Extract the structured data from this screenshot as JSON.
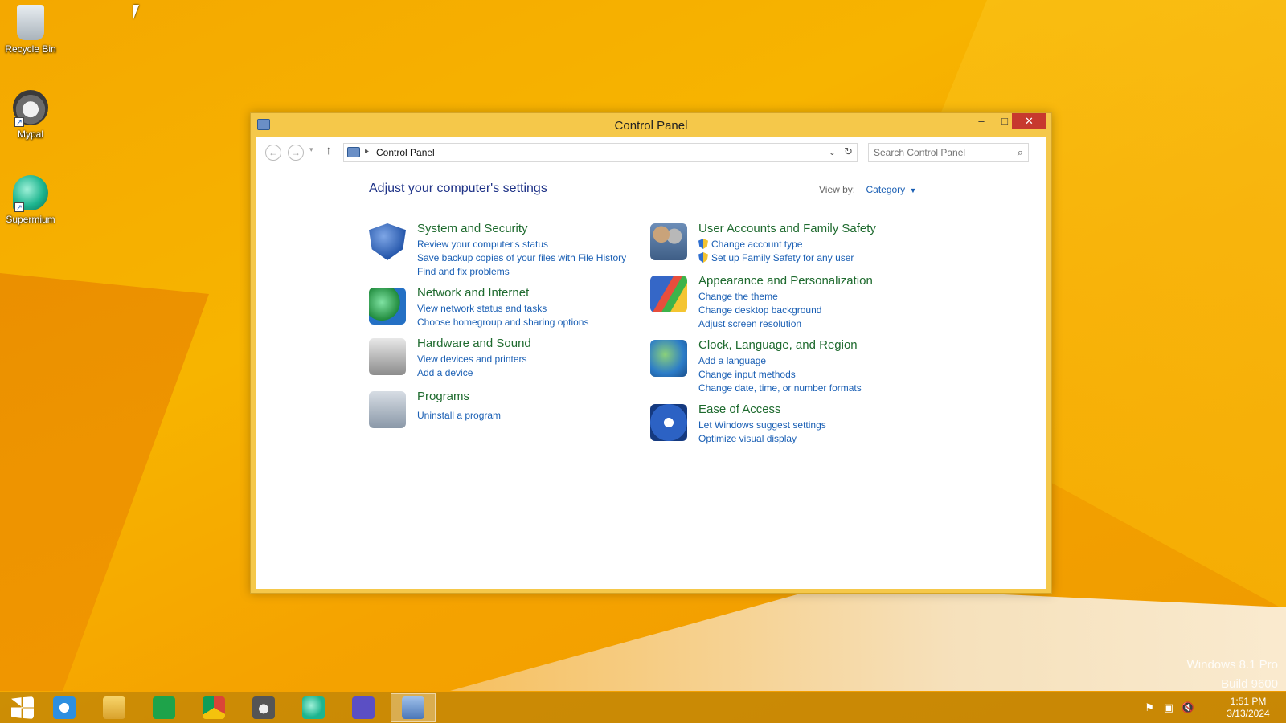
{
  "desktop": {
    "icons": [
      {
        "label": "Recycle Bin",
        "icon": "recycle-bin-icon"
      },
      {
        "label": "Mypal",
        "icon": "mypal-icon"
      },
      {
        "label": "Supermium",
        "icon": "supermium-icon"
      }
    ],
    "watermark": {
      "line1": "Windows 8.1 Pro",
      "line2": "Build 9600"
    }
  },
  "window": {
    "title": "Control Panel",
    "minimize": "–",
    "maximize": "□",
    "close": "✕",
    "address": {
      "back": "←",
      "forward": "→",
      "recent": "▾",
      "up": "↑",
      "separator": "▸",
      "crumb": "Control Panel",
      "dropdown": "⌄",
      "refresh": "↻"
    },
    "search": {
      "placeholder": "Search Control Panel",
      "value": "",
      "icon": "⌕"
    },
    "heading": "Adjust your computer's settings",
    "view_by": {
      "label": "View by:",
      "value": "Category",
      "caret": "▼"
    },
    "categories": [
      {
        "title": "System and Security",
        "icon": "shield-icon",
        "links": [
          "Review your computer's status",
          "Save backup copies of your files with File History",
          "Find and fix problems"
        ]
      },
      {
        "title": "Network and Internet",
        "icon": "network-icon",
        "links": [
          "View network status and tasks",
          "Choose homegroup and sharing options"
        ]
      },
      {
        "title": "Hardware and Sound",
        "icon": "printer-icon",
        "links": [
          "View devices and printers",
          "Add a device"
        ]
      },
      {
        "title": "Programs",
        "icon": "programs-icon",
        "links": [
          "Uninstall a program"
        ]
      },
      {
        "title": "User Accounts and Family Safety",
        "icon": "users-icon",
        "links": [
          "Change account type",
          "Set up Family Safety for any user"
        ]
      },
      {
        "title": "Appearance and Personalization",
        "icon": "appearance-icon",
        "links": [
          "Change the theme",
          "Change desktop background",
          "Adjust screen resolution"
        ]
      },
      {
        "title": "Clock, Language, and Region",
        "icon": "clock-globe-icon",
        "links": [
          "Add a language",
          "Change input methods",
          "Change date, time, or number formats"
        ]
      },
      {
        "title": "Ease of Access",
        "icon": "ease-of-access-icon",
        "links": [
          "Let Windows suggest settings",
          "Optimize visual display"
        ]
      }
    ]
  },
  "taskbar": {
    "items": [
      "start-icon",
      "internet-explorer-icon",
      "file-explorer-icon",
      "store-icon",
      "chrome-icon",
      "mypal-icon",
      "supermium-icon",
      "settings-icon",
      "control-panel-icon"
    ],
    "active_item": "control-panel-icon",
    "tray": {
      "flag": "⚑",
      "network": "▣",
      "volume": "🔇"
    },
    "clock": {
      "time": "1:51 PM",
      "date": "3/13/2024"
    }
  }
}
